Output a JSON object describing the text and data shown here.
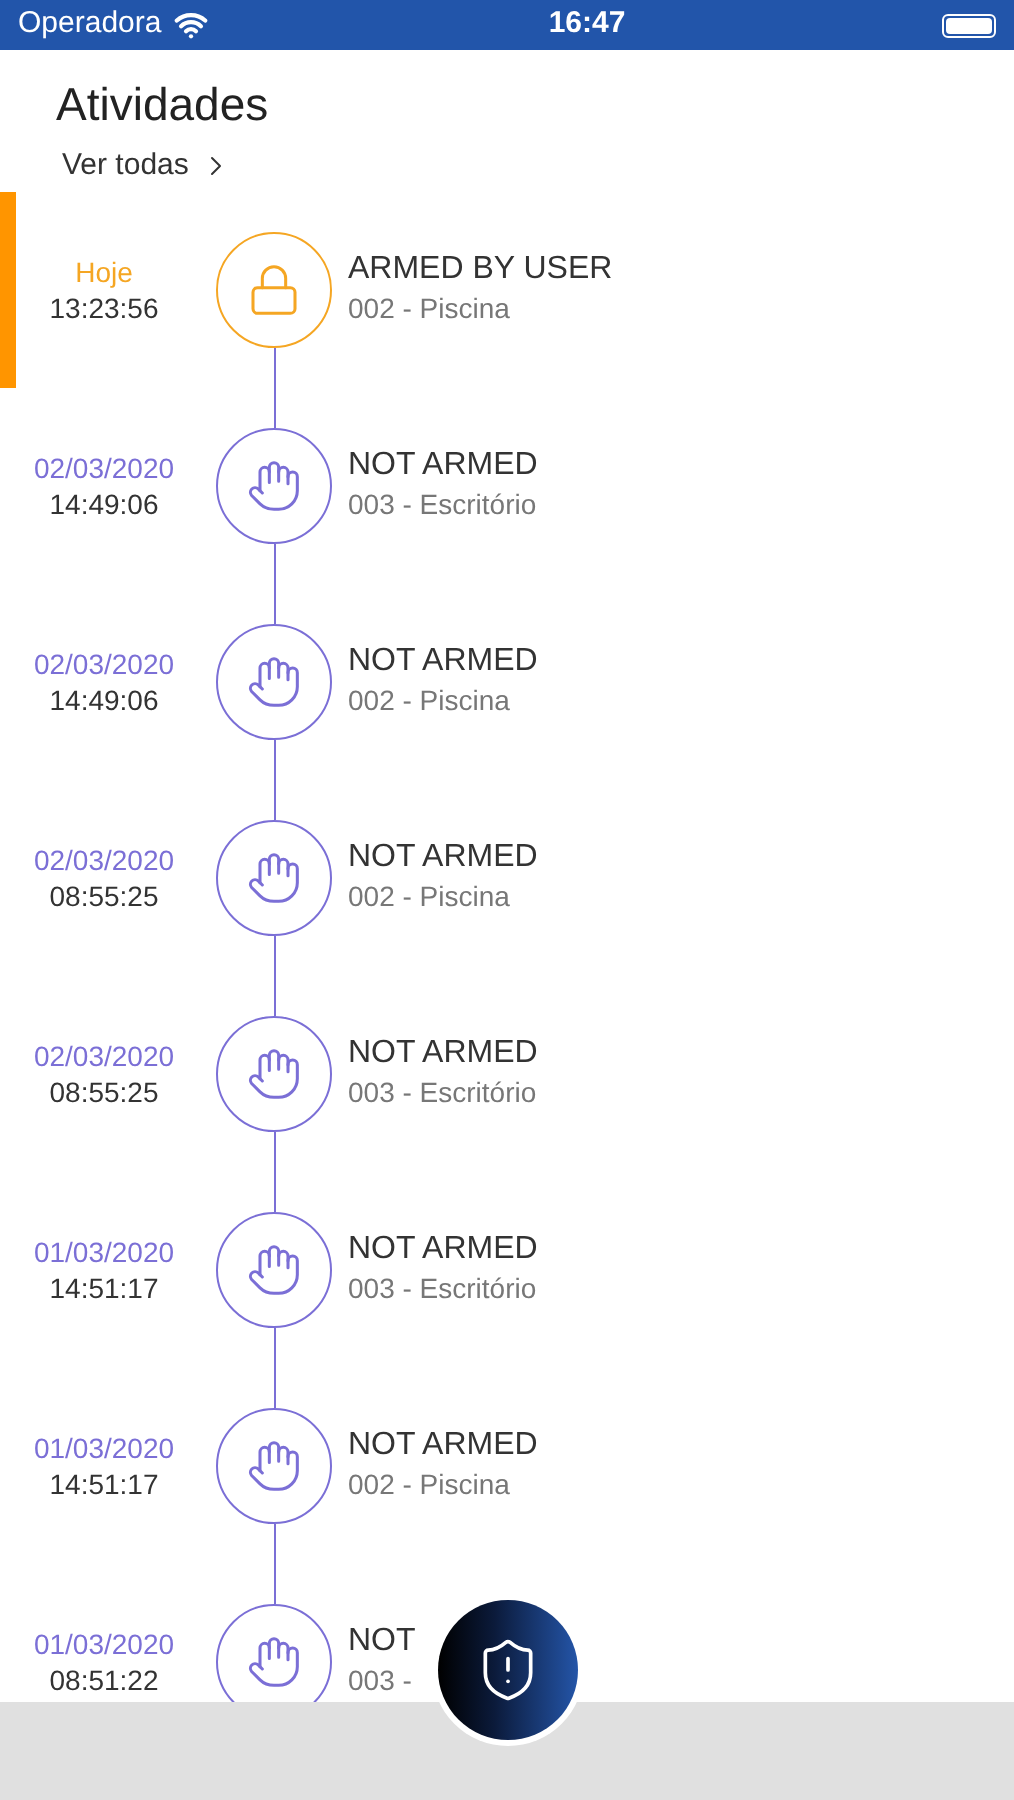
{
  "status_bar": {
    "carrier": "Operadora",
    "time": "16:47"
  },
  "header": {
    "title": "Atividades",
    "link": "Ver todas"
  },
  "events": [
    {
      "kind": "armed",
      "selected": true,
      "date": "Hoje",
      "time": "13:23:56",
      "title": "ARMED BY USER",
      "zone": "002 - Piscina"
    },
    {
      "kind": "not_armed",
      "selected": false,
      "date": "02/03/2020",
      "time": "14:49:06",
      "title": "NOT ARMED",
      "zone": "003 - Escritório"
    },
    {
      "kind": "not_armed",
      "selected": false,
      "date": "02/03/2020",
      "time": "14:49:06",
      "title": "NOT ARMED",
      "zone": "002 - Piscina"
    },
    {
      "kind": "not_armed",
      "selected": false,
      "date": "02/03/2020",
      "time": "08:55:25",
      "title": "NOT ARMED",
      "zone": "002 - Piscina"
    },
    {
      "kind": "not_armed",
      "selected": false,
      "date": "02/03/2020",
      "time": "08:55:25",
      "title": "NOT ARMED",
      "zone": "003 - Escritório"
    },
    {
      "kind": "not_armed",
      "selected": false,
      "date": "01/03/2020",
      "time": "14:51:17",
      "title": "NOT ARMED",
      "zone": "003 - Escritório"
    },
    {
      "kind": "not_armed",
      "selected": false,
      "date": "01/03/2020",
      "time": "14:51:17",
      "title": "NOT ARMED",
      "zone": "002 - Piscina"
    },
    {
      "kind": "not_armed",
      "selected": false,
      "date": "01/03/2020",
      "time": "08:51:22",
      "title": "NOT",
      "zone": "003 -"
    }
  ]
}
